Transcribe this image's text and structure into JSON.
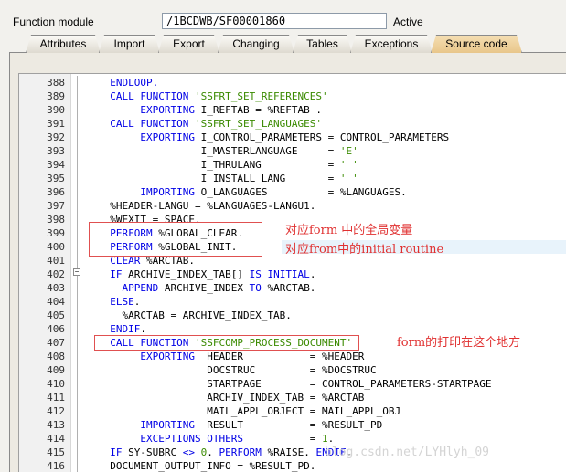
{
  "header": {
    "label": "Function module",
    "value": "/1BCDWB/SF00001860",
    "status": "Active"
  },
  "tabs": [
    "Attributes",
    "Import",
    "Export",
    "Changing",
    "Tables",
    "Exceptions",
    "Source code"
  ],
  "active_tab": "Source code",
  "code": [
    {
      "n": "388",
      "segs": [
        [
          "kw",
          "  ENDLOOP."
        ]
      ]
    },
    {
      "n": "389",
      "segs": [
        [
          "kw",
          "  CALL FUNCTION "
        ],
        [
          "str",
          "'SSFRT_SET_REFERENCES'"
        ]
      ]
    },
    {
      "n": "390",
      "segs": [
        [
          "kw",
          "       EXPORTING "
        ],
        [
          "t",
          "I_REFTAB = %REFTAB ."
        ]
      ]
    },
    {
      "n": "391",
      "segs": [
        [
          "kw",
          "  CALL FUNCTION "
        ],
        [
          "str",
          "'SSFRT_SET_LANGUAGES'"
        ]
      ]
    },
    {
      "n": "392",
      "segs": [
        [
          "kw",
          "       EXPORTING "
        ],
        [
          "t",
          "I_CONTROL_PARAMETERS = CONTROL_PARAMETERS"
        ]
      ]
    },
    {
      "n": "393",
      "segs": [
        [
          "t",
          "                 I_MASTERLANGUAGE     = "
        ],
        [
          "str",
          "'E'"
        ]
      ]
    },
    {
      "n": "394",
      "segs": [
        [
          "t",
          "                 I_THRULANG           = "
        ],
        [
          "str",
          "' '"
        ]
      ]
    },
    {
      "n": "395",
      "segs": [
        [
          "t",
          "                 I_INSTALL_LANG       = "
        ],
        [
          "str",
          "' '"
        ]
      ]
    },
    {
      "n": "396",
      "segs": [
        [
          "kw",
          "       IMPORTING "
        ],
        [
          "t",
          "O_LANGUAGES          = %LANGUAGES."
        ]
      ]
    },
    {
      "n": "397",
      "segs": [
        [
          "t",
          "  %HEADER-LANGU = %LANGUAGES-LANGU1."
        ]
      ]
    },
    {
      "n": "398",
      "segs": [
        [
          "t",
          "  %WEXIT = SPACE."
        ]
      ]
    },
    {
      "n": "399",
      "segs": [
        [
          "kw",
          "  PERFORM "
        ],
        [
          "t",
          "%GLOBAL_CLEAR."
        ]
      ]
    },
    {
      "n": "400",
      "segs": [
        [
          "kw",
          "  PERFORM "
        ],
        [
          "t",
          "%GLOBAL_INIT."
        ]
      ]
    },
    {
      "n": "401",
      "segs": [
        [
          "kw",
          "  CLEAR "
        ],
        [
          "t",
          "%ARCTAB."
        ]
      ]
    },
    {
      "n": "402",
      "segs": [
        [
          "kw",
          "  IF "
        ],
        [
          "t",
          "ARCHIVE_INDEX_TAB[] "
        ],
        [
          "kw",
          "IS INITIAL"
        ],
        [
          "t",
          "."
        ]
      ]
    },
    {
      "n": "403",
      "segs": [
        [
          "kw",
          "    APPEND "
        ],
        [
          "t",
          "ARCHIVE_INDEX "
        ],
        [
          "kw",
          "TO "
        ],
        [
          "t",
          "%ARCTAB."
        ]
      ]
    },
    {
      "n": "404",
      "segs": [
        [
          "kw",
          "  ELSE"
        ],
        [
          "t",
          "."
        ]
      ]
    },
    {
      "n": "405",
      "segs": [
        [
          "t",
          "    %ARCTAB = ARCHIVE_INDEX_TAB."
        ]
      ]
    },
    {
      "n": "406",
      "segs": [
        [
          "kw",
          "  ENDIF"
        ],
        [
          "t",
          "."
        ]
      ]
    },
    {
      "n": "407",
      "segs": [
        [
          "kw",
          "  CALL FUNCTION "
        ],
        [
          "str",
          "'SSFCOMP_PROCESS_DOCUMENT'"
        ]
      ]
    },
    {
      "n": "408",
      "segs": [
        [
          "kw",
          "       EXPORTING  "
        ],
        [
          "t",
          "HEADER           = %HEADER"
        ]
      ]
    },
    {
      "n": "409",
      "segs": [
        [
          "t",
          "                  DOCSTRUC         = %DOCSTRUC"
        ]
      ]
    },
    {
      "n": "410",
      "segs": [
        [
          "t",
          "                  STARTPAGE        = CONTROL_PARAMETERS-STARTPAGE"
        ]
      ]
    },
    {
      "n": "411",
      "segs": [
        [
          "t",
          "                  ARCHIV_INDEX_TAB = %ARCTAB"
        ]
      ]
    },
    {
      "n": "412",
      "segs": [
        [
          "t",
          "                  MAIL_APPL_OBJECT = MAIL_APPL_OBJ"
        ]
      ]
    },
    {
      "n": "413",
      "segs": [
        [
          "kw",
          "       IMPORTING  "
        ],
        [
          "t",
          "RESULT           = %RESULT_PD"
        ]
      ]
    },
    {
      "n": "414",
      "segs": [
        [
          "kw",
          "       EXCEPTIONS OTHERS           "
        ],
        [
          "t",
          "= "
        ],
        [
          "num",
          "1"
        ],
        [
          "t",
          "."
        ]
      ]
    },
    {
      "n": "415",
      "segs": [
        [
          "kw",
          "  IF "
        ],
        [
          "t",
          "SY-SUBRC "
        ],
        [
          "kw",
          "<> "
        ],
        [
          "num",
          "0"
        ],
        [
          "t",
          ". "
        ],
        [
          "kw",
          "PERFORM "
        ],
        [
          "t",
          "%RAISE. "
        ],
        [
          "kw",
          "ENDIF"
        ],
        [
          "t",
          "."
        ]
      ]
    },
    {
      "n": "416",
      "segs": [
        [
          "t",
          "  DOCUMENT_OUTPUT_INFO = %RESULT_PD."
        ]
      ]
    }
  ],
  "annotations": {
    "global_vars": "对应form 中的全局变量",
    "init_routine": "对应from中的initial routine",
    "print_here": "form的打印在这个地方"
  },
  "watermark": "blog.csdn.net/LYHlyh_09",
  "colors": {
    "keyword": "#0000e6",
    "string": "#3a8a00",
    "annotation": "#e03030",
    "active_tab": "#e8c68a"
  }
}
